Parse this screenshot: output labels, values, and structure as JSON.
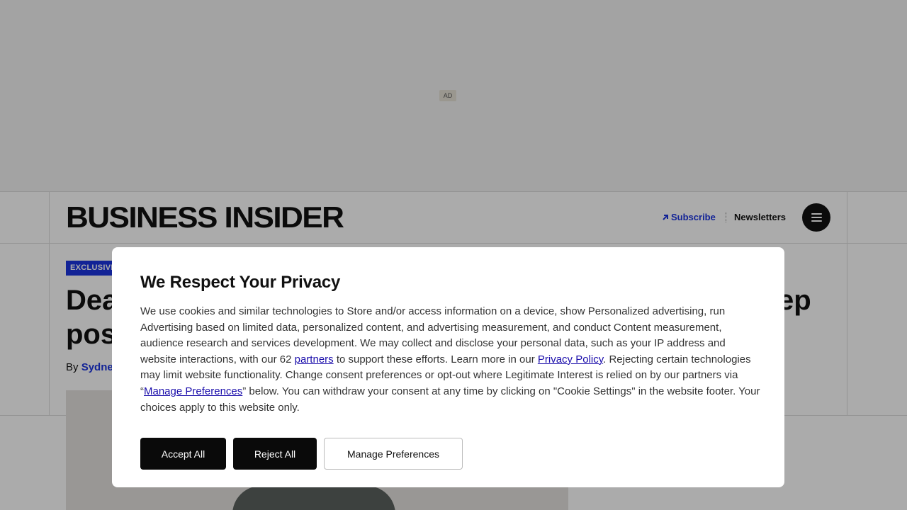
{
  "ad": {
    "label": "AD"
  },
  "header": {
    "logo": "BUSINESS INSIDER",
    "subscribe_label": "Subscribe",
    "newsletters_label": "Newsletters"
  },
  "article": {
    "tag": "EXCLUSIVE",
    "headline_line1_visible": "Dea",
    "headline_line1_right_visible": "ep",
    "headline_line2_visible": "pos",
    "byline_prefix": "By",
    "author_visible": "Sydne"
  },
  "consent": {
    "title": "We Respect Your Privacy",
    "body_part1": "We use cookies and similar technologies to Store and/or access information on a device, show Personalized advertising, run Advertising based on limited data, personalized content, and advertising measurement, and conduct Content measurement, audience research and services development. We may collect and disclose your personal data, such as your IP address and website interactions, with our 62 ",
    "partners_link": "partners",
    "body_part2": " to support these efforts. Learn more in our ",
    "privacy_link": "Privacy Policy",
    "body_part3": ". Rejecting certain technologies may limit website functionality. Change consent preferences or opt-out where Legitimate Interest is relied on by our partners via “",
    "manage_link": "Manage Preferences",
    "body_part4": "” below. You can withdraw your consent at any time by clicking on \"Cookie Settings\" in the website footer. Your choices apply to this website only.",
    "accept_label": "Accept All",
    "reject_label": "Reject All",
    "manage_label": "Manage Preferences"
  },
  "colors": {
    "accent_blue": "#1c35e0",
    "button_dark": "#0a0a0a",
    "link": "#1a0dab"
  },
  "icons": [
    "arrow-up-right-icon",
    "menu-icon"
  ]
}
